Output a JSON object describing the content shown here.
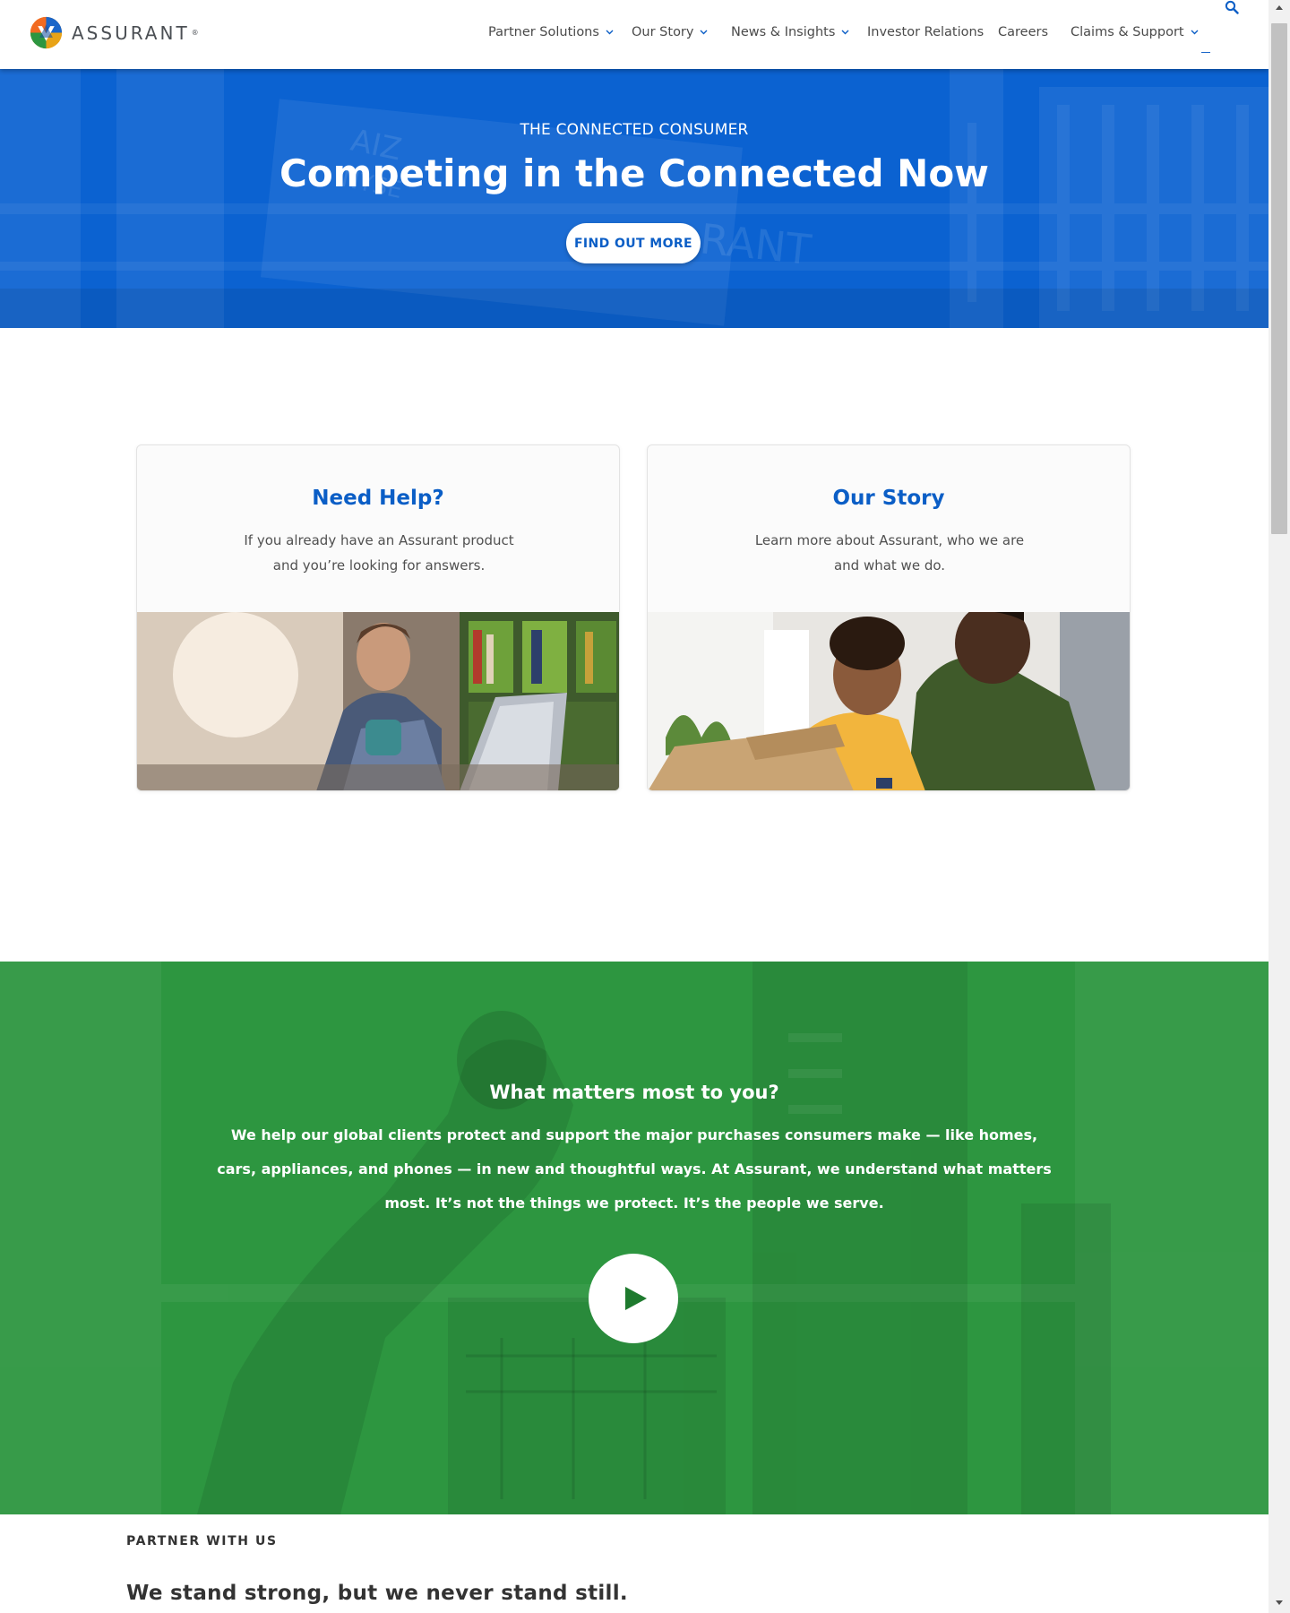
{
  "header": {
    "logo_text": "ASSURANT",
    "logo_mark": "®",
    "nav": [
      {
        "label": "Partner Solutions",
        "has_dropdown": true
      },
      {
        "label": "Our Story",
        "has_dropdown": true
      },
      {
        "label": "News & Insights",
        "has_dropdown": true
      },
      {
        "label": "Investor Relations",
        "has_dropdown": false
      },
      {
        "label": "Careers",
        "has_dropdown": false
      },
      {
        "label": "Claims & Support",
        "has_dropdown": true
      }
    ],
    "search_icon": "search-icon"
  },
  "hero": {
    "eyebrow": "THE CONNECTED CONSUMER",
    "title": "Competing in the Connected Now",
    "button": "FIND OUT MORE",
    "bg_color": "#0b62d1"
  },
  "cards": {
    "help": {
      "title": "Need Help?",
      "desc": "If you already have an Assurant product and you’re looking for answers."
    },
    "story": {
      "title": "Our Story",
      "desc": "Learn more about Assurant, who we are and what we do."
    }
  },
  "video": {
    "heading": "What matters most to you?",
    "body": "We help our global clients protect and support the major purchases consumers make — like homes, cars, appliances, and phones — in new and thoughtful ways. At Assurant, we understand what matters most. It’s not the things we protect. It’s the people we serve.",
    "play_icon": "play-icon",
    "bg_color": "#2d9640"
  },
  "partner": {
    "eyebrow": "PARTNER WITH US",
    "title": "We stand strong, but we never stand still."
  },
  "colors": {
    "brand_blue": "#0b5ec6",
    "brand_green": "#2d9640",
    "text_dark": "#333333"
  }
}
